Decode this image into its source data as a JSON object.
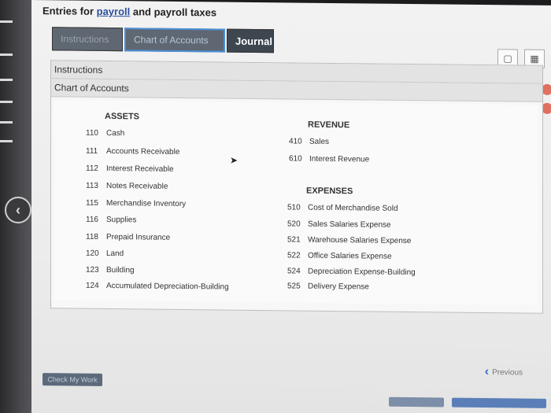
{
  "page": {
    "title_prefix": "Entries for ",
    "title_link": "payroll",
    "title_suffix": " and payroll taxes"
  },
  "tabs": [
    {
      "label": "Instructions"
    },
    {
      "label": "Chart of Accounts"
    },
    {
      "label": "Journal"
    }
  ],
  "panel": {
    "row1": "Instructions",
    "row2": "Chart of Accounts"
  },
  "chart_of_accounts": {
    "assets_heading": "ASSETS",
    "revenue_heading": "REVENUE",
    "expenses_heading": "EXPENSES",
    "assets": [
      {
        "num": "110",
        "name": "Cash"
      },
      {
        "num": "111",
        "name": "Accounts Receivable"
      },
      {
        "num": "112",
        "name": "Interest Receivable"
      },
      {
        "num": "113",
        "name": "Notes Receivable"
      },
      {
        "num": "115",
        "name": "Merchandise Inventory"
      },
      {
        "num": "116",
        "name": "Supplies"
      },
      {
        "num": "118",
        "name": "Prepaid Insurance"
      },
      {
        "num": "120",
        "name": "Land"
      },
      {
        "num": "123",
        "name": "Building"
      },
      {
        "num": "124",
        "name": "Accumulated Depreciation-Building"
      }
    ],
    "revenue": [
      {
        "num": "410",
        "name": "Sales"
      },
      {
        "num": "610",
        "name": "Interest Revenue"
      }
    ],
    "expenses": [
      {
        "num": "510",
        "name": "Cost of Merchandise Sold"
      },
      {
        "num": "520",
        "name": "Sales Salaries Expense"
      },
      {
        "num": "521",
        "name": "Warehouse Salaries Expense"
      },
      {
        "num": "522",
        "name": "Office Salaries Expense"
      },
      {
        "num": "524",
        "name": "Depreciation Expense-Building"
      },
      {
        "num": "525",
        "name": "Delivery Expense"
      }
    ]
  },
  "footer": {
    "check_label": "Check My Work",
    "previous_label": "Previous"
  },
  "icons": {
    "back": "chevron-left-icon",
    "previous": "chevron-left-icon",
    "print": "print-icon",
    "calculator": "calculator-icon"
  },
  "colors": {
    "link": "#2c4f9e",
    "active_tab_border": "#4b8fd6",
    "tab_bg": "#5e6772",
    "journal_tab_bg": "#3e4650"
  }
}
